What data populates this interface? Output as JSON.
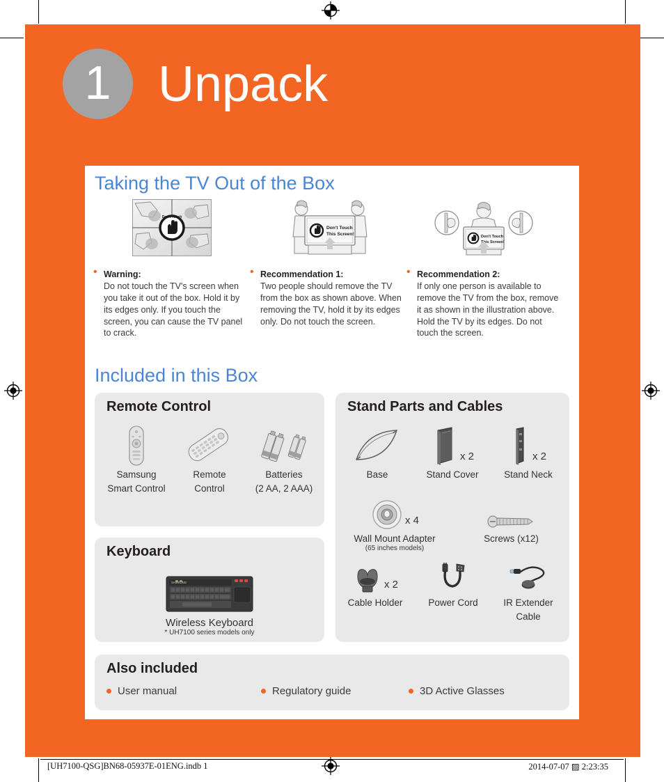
{
  "header": {
    "step_number": "1",
    "title": "Unpack"
  },
  "colors": {
    "orange": "#f26522",
    "blue": "#4a86d6",
    "gray_circle": "#a3a3a3",
    "box_gray": "#e9e9e9"
  },
  "sections": {
    "taking": {
      "title": "Taking the TV Out of the Box",
      "illustrations": [
        {
          "name": "four-hands-on-screen-grid",
          "caption": "Don't Touch This Screen!"
        },
        {
          "name": "two-people-lifting-tv",
          "caption": "Don't Touch This Screen!"
        },
        {
          "name": "one-person-lifting-tv",
          "caption": "Don't Touch This Screen!"
        }
      ],
      "notes": [
        {
          "heading": "Warning:",
          "body": "Do not touch the TV's screen when you take it out of the box. Hold it by its edges only. If you touch the screen, you can cause the TV panel to crack."
        },
        {
          "heading": "Recommendation 1:",
          "body": "Two people should remove the TV from the box as shown above. When removing the TV, hold it by its edges only. Do not touch the screen."
        },
        {
          "heading": "Recommendation 2:",
          "body": "If only one person is available to remove the TV from the box, remove it as shown in the illustration above. Hold the TV by its edges. Do not touch the screen."
        }
      ]
    },
    "included": {
      "title": "Included in this Box",
      "remote_box": {
        "title": "Remote Control",
        "items": [
          {
            "label": "Samsung\nSmart Control",
            "label_line1": "Samsung",
            "label_line2": "Smart Control",
            "qty": "",
            "icon": "smart-remote-icon"
          },
          {
            "label": "Remote\nControl",
            "label_line1": "Remote",
            "label_line2": "Control",
            "qty": "",
            "icon": "standard-remote-icon"
          },
          {
            "label": "Batteries\n(2 AA, 2 AAA)",
            "label_line1": "Batteries",
            "label_line2": "(2 AA, 2 AAA)",
            "qty": "",
            "icon": "batteries-icon"
          }
        ]
      },
      "keyboard_box": {
        "title": "Keyboard",
        "item": {
          "label": "Wireless Keyboard",
          "note": "* UH7100 series models only",
          "icon": "wireless-keyboard-icon"
        }
      },
      "stand_box": {
        "title": "Stand Parts and Cables",
        "items": [
          {
            "label_line1": "Base",
            "label_line2": "",
            "qty": "",
            "icon": "stand-base-icon"
          },
          {
            "label_line1": "Stand Cover",
            "label_line2": "",
            "qty": "x 2",
            "icon": "stand-cover-icon"
          },
          {
            "label_line1": "Stand Neck",
            "label_line2": "",
            "qty": "x 2",
            "icon": "stand-neck-icon"
          },
          {
            "label_line1": "Wall Mount Adapter",
            "label_line2": "(65 inches models)",
            "qty": "x 4",
            "icon": "wall-mount-adapter-icon"
          },
          {
            "label_line1": "Screws (x12)",
            "label_line2": "",
            "qty": "",
            "icon": "screw-icon"
          },
          {
            "label_line1": "Cable Holder",
            "label_line2": "",
            "qty": "x 2",
            "icon": "cable-holder-icon"
          },
          {
            "label_line1": "Power Cord",
            "label_line2": "",
            "qty": "",
            "icon": "power-cord-icon"
          },
          {
            "label_line1": "IR Extender",
            "label_line2": "Cable",
            "qty": "",
            "icon": "ir-extender-cable-icon"
          }
        ]
      },
      "also_box": {
        "title": "Also included",
        "items": [
          "User manual",
          "Regulatory guide",
          "3D Active Glasses"
        ]
      }
    }
  },
  "footer": {
    "left": "[UH7100-QSG]BN68-05937E-01ENG.indb   1",
    "right": "2014-07-07   ▨ 2:23:35"
  }
}
